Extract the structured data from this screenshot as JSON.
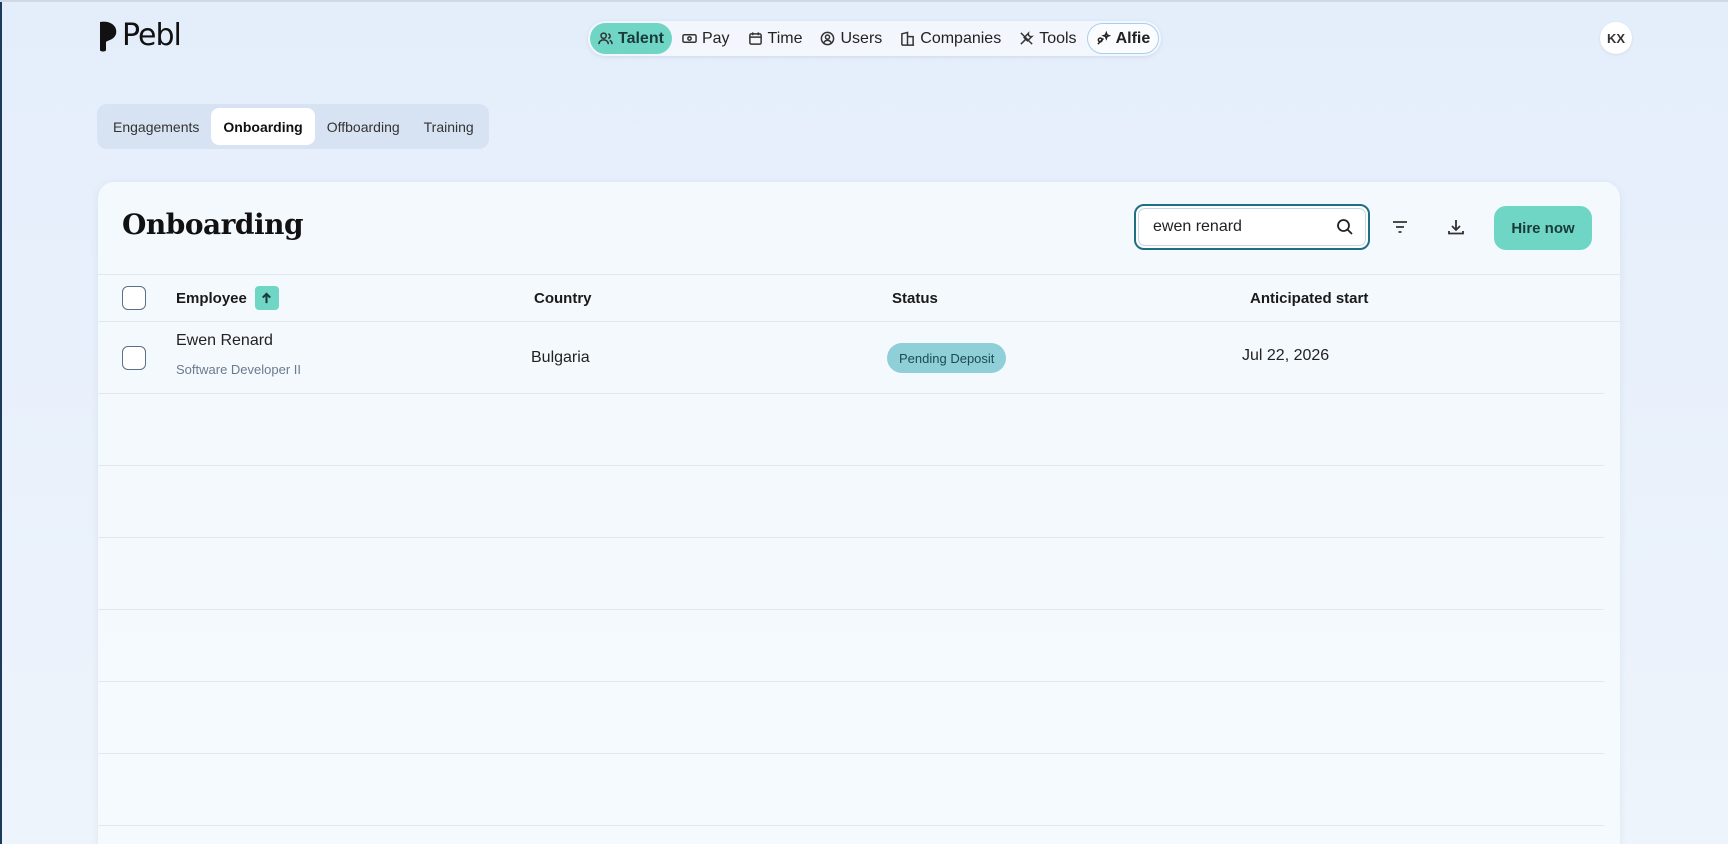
{
  "brand": {
    "name": "Pebl"
  },
  "topnav": {
    "items": [
      {
        "label": "Talent",
        "icon": "users-icon",
        "active": true
      },
      {
        "label": "Pay",
        "icon": "money-icon"
      },
      {
        "label": "Time",
        "icon": "calendar-icon"
      },
      {
        "label": "Users",
        "icon": "user-circle-icon"
      },
      {
        "label": "Companies",
        "icon": "building-icon"
      },
      {
        "label": "Tools",
        "icon": "tools-icon"
      },
      {
        "label": "Alfie",
        "icon": "sparkle-icon"
      }
    ]
  },
  "user": {
    "initials": "KX"
  },
  "subtabs": [
    {
      "label": "Engagements"
    },
    {
      "label": "Onboarding",
      "active": true
    },
    {
      "label": "Offboarding"
    },
    {
      "label": "Training"
    }
  ],
  "page": {
    "title": "Onboarding",
    "search_value": "ewen renard",
    "hire_label": "Hire now"
  },
  "table": {
    "columns": [
      "Employee",
      "Country",
      "Status",
      "Anticipated start"
    ],
    "rows": [
      {
        "name": "Ewen Renard",
        "role": "Software Developer II",
        "country": "Bulgaria",
        "status": "Pending Deposit",
        "start": "Jul 22, 2026"
      }
    ]
  },
  "colors": {
    "accent": "#6fd6c6",
    "status_badge": "#8fcfd8",
    "focus_border": "#1e6f82"
  }
}
